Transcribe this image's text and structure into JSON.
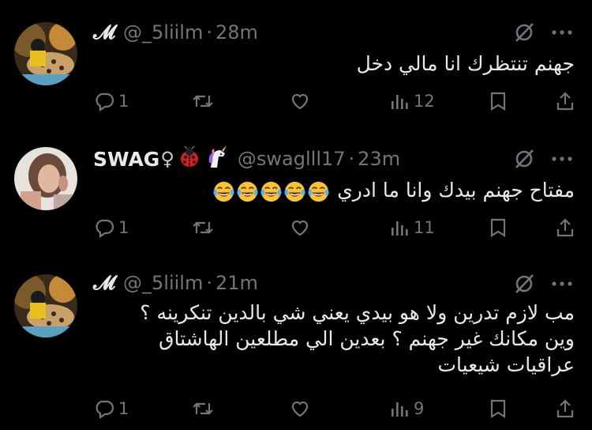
{
  "tweets": [
    {
      "name": "𝓜",
      "handle": "@_5liilm",
      "time": "28m",
      "text_lines": [
        "جهنم تنتظرك انا مالي دخل"
      ],
      "replies": "1",
      "views": "12"
    },
    {
      "name": "SWAG",
      "name_suffix": "♀",
      "handle": "@swaglll17",
      "time": "23m",
      "text_lines": [
        "مفتاح جهنم بيدك وانا ما ادري"
      ],
      "emoji": [
        "ladybug-emoji",
        "unicorn-emoji"
      ],
      "trailing_emoji": [
        "😂",
        "😂",
        "😂",
        "😂",
        "😂"
      ],
      "replies": "1",
      "views": "11"
    },
    {
      "name": "𝓜",
      "handle": "@_5liilm",
      "time": "21m",
      "text_lines": [
        "مب لازم تدرين ولا هو بيدي يعني شي بالدين تنكرينه ؟",
        "وين مكانك غير جهنم ؟ بعدين الي مطلعين الهاشتاق",
        "عراقيات شيعيات"
      ],
      "replies": "1",
      "views": "9"
    }
  ],
  "separator": "·",
  "colors": {
    "background": "#000000",
    "text": "#e7e9ea",
    "muted": "#71767b"
  }
}
